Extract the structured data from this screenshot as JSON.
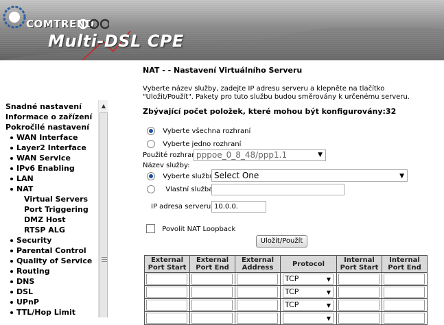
{
  "header": {
    "brand": "COMTREND",
    "product": "Multi-DSL CPE"
  },
  "sidebar": {
    "items": [
      {
        "label": "Snadné nastavení",
        "level": 1
      },
      {
        "label": "Informace o zařízení",
        "level": 1
      },
      {
        "label": "Pokročilé nastavení",
        "level": 1
      },
      {
        "label": "WAN Interface",
        "level": 2
      },
      {
        "label": "Layer2 Interface",
        "level": 2
      },
      {
        "label": "WAN Service",
        "level": 2
      },
      {
        "label": "IPv6 Enabling",
        "level": 2
      },
      {
        "label": "LAN",
        "level": 2
      },
      {
        "label": "NAT",
        "level": 2
      },
      {
        "label": "Virtual Servers",
        "level": 3
      },
      {
        "label": "Port Triggering",
        "level": 3
      },
      {
        "label": "DMZ Host",
        "level": 3
      },
      {
        "label": "RTSP ALG",
        "level": 3
      },
      {
        "label": "Security",
        "level": 2
      },
      {
        "label": "Parental Control",
        "level": 2
      },
      {
        "label": "Quality of Service",
        "level": 2
      },
      {
        "label": "Routing",
        "level": 2
      },
      {
        "label": "DNS",
        "level": 2
      },
      {
        "label": "DSL",
        "level": 2
      },
      {
        "label": "UPnP",
        "level": 2
      },
      {
        "label": "TTL/Hop Limit",
        "level": 2
      }
    ]
  },
  "main": {
    "title": "NAT - - Nastavení Virtuálního Serveru",
    "description": "Vyberte název služby, zadejte IP adresu serveru a klepněte na tlačítko \"Uložit/Použít\". Pakety pro tuto službu budou směrovány k určenému serveru.",
    "remaining": "Zbývající počet položek, které mohou být konfigurovány:32",
    "radio_all_interfaces": "Vyberte všechna rozhraní",
    "radio_one_interface": "Vyberte jedno rozhraní",
    "used_interface_label": "Použité rozhraní",
    "used_interface_value": "pppoe_0_8_48/ppp1.1",
    "service_name_label": "Název služby:",
    "select_service_label": "Vyberte službu:",
    "select_service_value": "Select One",
    "custom_service_label": "Vlastní služba:",
    "custom_service_value": "",
    "server_ip_label": "IP adresa serveru:",
    "server_ip_value": "10.0.0.",
    "nat_loopback_label": "Povolit NAT Loopback",
    "save_button": "Uložit/Použít"
  },
  "table": {
    "headers": [
      "External Port Start",
      "External Port End",
      "External Address",
      "Protocol",
      "Internal Port Start",
      "Internal Port End"
    ],
    "rows": [
      {
        "protocol": "TCP"
      },
      {
        "protocol": "TCP"
      },
      {
        "protocol": "TCP"
      },
      {
        "protocol": ""
      }
    ]
  },
  "colors": {
    "radio_selected": "#1f4e9e",
    "table_header_bg": "#d9d9d9"
  }
}
